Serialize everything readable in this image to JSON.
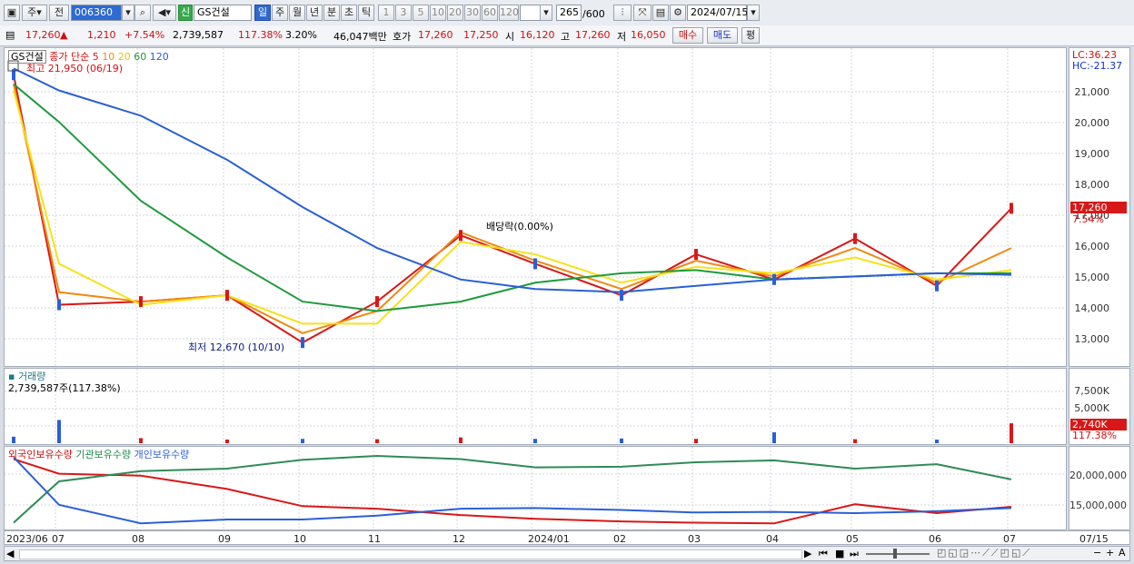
{
  "toolbar": {
    "mode_1": "주",
    "mode_2": "전",
    "code": "006360",
    "badge": "신",
    "stock_name": "GS건설",
    "periods": [
      "일",
      "주",
      "월",
      "년",
      "분",
      "초",
      "틱"
    ],
    "active_period": "일",
    "numbers": [
      "1",
      "3",
      "5",
      "10",
      "20",
      "30",
      "60",
      "120"
    ],
    "count": "265",
    "count_total": "/600",
    "date": "2024/07/15"
  },
  "info": {
    "price": "17,260",
    "change": "1,210",
    "change_pct": "+7.54%",
    "volume": "2,739,587",
    "vol_ratio": "117.38%",
    "turnover": "3.20%",
    "amount": "46,047백만",
    "ask_label": "호가",
    "ask1": "17,260",
    "ask2": "17,250",
    "open_label": "시",
    "open": "16,120",
    "high_label": "고",
    "high": "17,260",
    "low_label": "저",
    "low": "16,050",
    "buy": "매수",
    "sell": "매도",
    "avg": "평"
  },
  "price_panel": {
    "name": "GS건설",
    "ma_label": "종가 단순",
    "ma_periods": [
      "5",
      "10",
      "20",
      "60",
      "120"
    ],
    "ma_colors": [
      "#d81818",
      "#f08a10",
      "#f5e21a",
      "#1e9a3c",
      "#2a5fd6"
    ],
    "high_note": "최고 21,950 (06/19)",
    "low_note": "최저 12,670 (10/10)",
    "dividend_note": "배당락(0.00%)",
    "lc": "LC:36.23",
    "hc": "HC:-21.37",
    "current_tag": "17,260",
    "current_pct": "7.54%",
    "yticks": [
      "21,000",
      "20,000",
      "19,000",
      "18,000",
      "17,000",
      "16,000",
      "15,000",
      "14,000",
      "13,000"
    ]
  },
  "volume_panel": {
    "title": "거래량",
    "value": "2,739,587주(117.38%)",
    "yticks": [
      "7,500K",
      "5,000K",
      "2,500K"
    ],
    "current_tag": "2,740K",
    "current_pct": "117.38%"
  },
  "holdings_panel": {
    "legend": [
      "외국인보유수량",
      "기관보유수량",
      "개인보유수량"
    ],
    "yticks": [
      "20,000,000",
      "15,000,000"
    ]
  },
  "xaxis": [
    "2023/06",
    "07",
    "08",
    "09",
    "10",
    "11",
    "12",
    "2024/01",
    "02",
    "03",
    "04",
    "05",
    "06",
    "07"
  ],
  "xaxis_right": "07/15",
  "chart_data": {
    "type": "line",
    "x": [
      "2023/06",
      "07",
      "08",
      "09",
      "10",
      "11",
      "12",
      "2024/01",
      "02",
      "03",
      "04",
      "05",
      "06",
      "07"
    ],
    "series": [
      {
        "name": "5",
        "values": [
          21500,
          14200,
          14300,
          14500,
          13000,
          14300,
          16400,
          15500,
          14500,
          15800,
          15000,
          16300,
          14800,
          17260
        ]
      },
      {
        "name": "10",
        "values": [
          21200,
          14600,
          14300,
          14500,
          13300,
          14000,
          16500,
          15600,
          14700,
          15600,
          15100,
          16000,
          14900,
          16000
        ]
      },
      {
        "name": "20",
        "values": [
          21000,
          15500,
          14200,
          14500,
          13600,
          13600,
          16200,
          15800,
          14900,
          15400,
          15200,
          15700,
          15000,
          15300
        ]
      },
      {
        "name": "60",
        "values": [
          21200,
          20000,
          17500,
          15700,
          14300,
          14000,
          14300,
          14900,
          15200,
          15300,
          15000,
          15100,
          15200,
          15200
        ]
      },
      {
        "name": "120",
        "values": [
          21700,
          21000,
          20200,
          18800,
          17300,
          16000,
          15000,
          14700,
          14600,
          14800,
          15000,
          15100,
          15200,
          15150
        ]
      }
    ],
    "ylim": [
      12400,
      22200
    ],
    "volume": [
      900,
      3200,
      700,
      500,
      600,
      550,
      800,
      600,
      650,
      600,
      1500,
      550,
      500,
      2740
    ],
    "volume_ylim": [
      0,
      9000
    ],
    "holdings_series": [
      {
        "name": "외국인보유수량",
        "values": [
          22500,
          20200,
          19900,
          17800,
          15100,
          14700,
          13700,
          13100,
          12700,
          12500,
          12400,
          15400,
          14000,
          15000
        ]
      },
      {
        "name": "기관보유수량",
        "values": [
          12500,
          19000,
          20600,
          21000,
          22400,
          23000,
          22500,
          21200,
          21300,
          22000,
          22300,
          21000,
          21700,
          19300
        ]
      },
      {
        "name": "개인보유수량",
        "values": [
          22800,
          15300,
          12400,
          13000,
          13000,
          13600,
          14700,
          14800,
          14500,
          14100,
          14200,
          14000,
          14300,
          14800
        ]
      }
    ],
    "holdings_ylim": [
      12000,
      24000
    ]
  }
}
